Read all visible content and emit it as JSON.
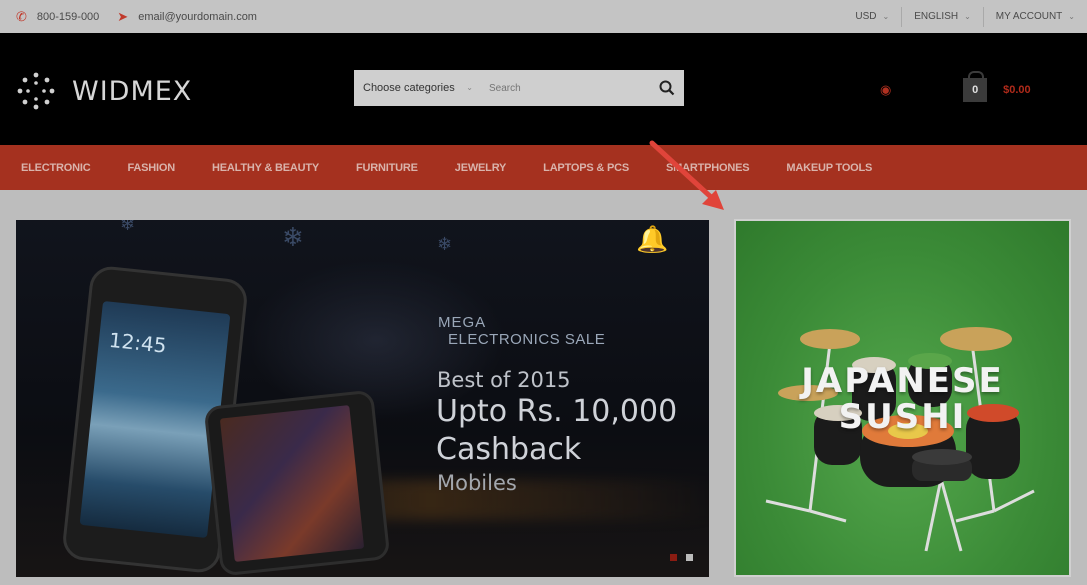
{
  "topbar": {
    "phone": "800-159-000",
    "email": "email@yourdomain.com",
    "currency": "USD",
    "language": "ENGLISH",
    "account": "MY ACCOUNT"
  },
  "header": {
    "logo": "WIDMEX",
    "search_category": "Choose categories",
    "search_placeholder": "Search",
    "cart_count": "0",
    "cart_total": "$0.00"
  },
  "nav": {
    "items": [
      "ELECTRONIC",
      "FASHION",
      "HEALTHY & BEAUTY",
      "FURNITURE",
      "JEWELRY",
      "LAPTOPS & PCS",
      "SMARTPHONES",
      "MAKEUP TOOLS"
    ]
  },
  "banner": {
    "brand_line1": "MEGA",
    "brand_line2": "ELECTRONICS SALE",
    "phone_time": "12:45",
    "line1": "Best of 2015",
    "line2": "Upto Rs. 10,000",
    "line3": "Cashback",
    "line4": "Mobiles"
  },
  "promo": {
    "line1": "JAPANESE",
    "line2": "SUSHI"
  },
  "colors": {
    "accent": "#a5311f",
    "header_bg": "#000000",
    "promo_bg": "#3e8e3a",
    "annotation_arrow": "#e0443a"
  }
}
